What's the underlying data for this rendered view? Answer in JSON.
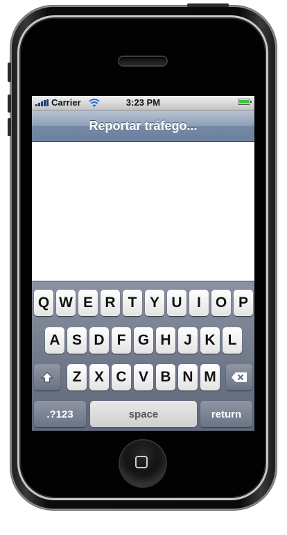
{
  "status_bar": {
    "carrier": "Carrier",
    "time": "3:23 PM"
  },
  "nav_bar": {
    "title": "Reportar tráfego..."
  },
  "keyboard": {
    "row1": [
      "Q",
      "W",
      "E",
      "R",
      "T",
      "Y",
      "U",
      "I",
      "O",
      "P"
    ],
    "row2": [
      "A",
      "S",
      "D",
      "F",
      "G",
      "H",
      "J",
      "K",
      "L"
    ],
    "row3": [
      "Z",
      "X",
      "C",
      "V",
      "B",
      "N",
      "M"
    ],
    "numbers_label": ".?123",
    "space_label": "space",
    "return_label": "return"
  },
  "icons": {
    "shift": "shift-icon",
    "delete": "backspace-icon",
    "signal": "signal-bars-icon",
    "wifi": "wifi-icon",
    "battery": "battery-icon",
    "home": "home-button-icon"
  },
  "colors": {
    "nav_bar": "#7589a4",
    "keyboard_bg": "#6d7687",
    "battery_level": "#3ec53c"
  }
}
